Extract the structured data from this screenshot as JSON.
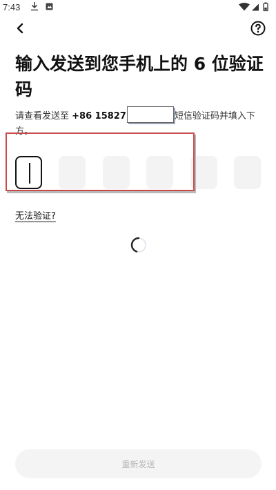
{
  "status_bar": {
    "time": "7:43",
    "icons": [
      "download-icon",
      "notification-icon",
      "wifi-icon",
      "signal-icon",
      "battery-icon"
    ]
  },
  "header": {
    "back_icon": "back-chevron-icon",
    "help_icon": "help-circle-icon"
  },
  "main": {
    "title": "输入发送到您手机上的 6 位验证码",
    "subtitle_prefix": "请查看发送至 ",
    "phone_prefix": "+86 15827",
    "subtitle_suffix": "短信验证码并填入下方。",
    "code_length": 6,
    "cant_verify_link": "无法验证?"
  },
  "footer": {
    "resend_label": "重新发送"
  },
  "colors": {
    "highlight_border": "#c84a4a",
    "code_box_bg": "#f3f3f3",
    "resend_bg": "#f4f4f4",
    "resend_text": "#b5b5b5"
  }
}
